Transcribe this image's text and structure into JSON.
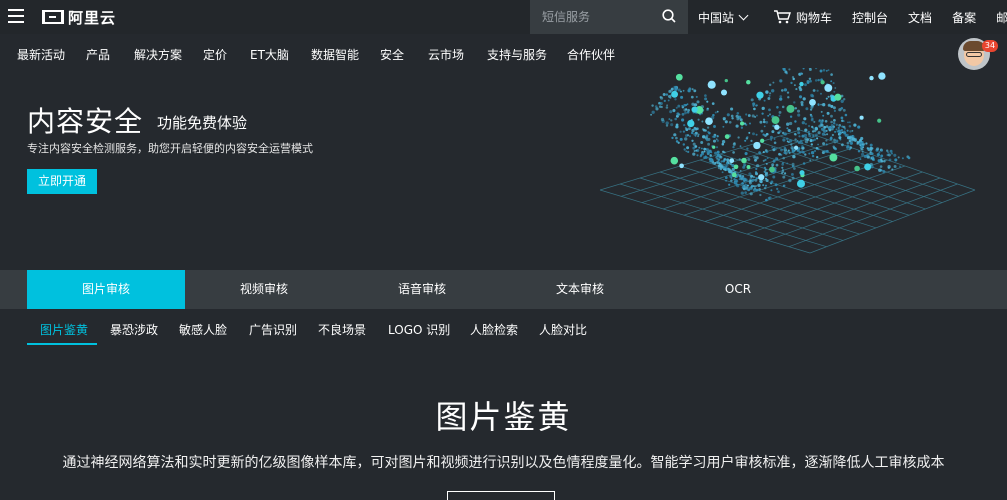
{
  "topbar": {
    "logo_text": "阿里云",
    "search_placeholder": "短信服务",
    "region": "中国站",
    "cart": "购物车",
    "links": [
      "控制台",
      "文档",
      "备案",
      "邮箱"
    ]
  },
  "mainnav": {
    "items": [
      "最新活动",
      "产品",
      "解决方案",
      "定价",
      "ET大脑",
      "数据智能",
      "安全",
      "云市场",
      "支持与服务",
      "合作伙伴"
    ]
  },
  "user": {
    "badge_count": "34"
  },
  "hero": {
    "title": "内容安全",
    "subtitle": "功能免费体验",
    "description": "专注内容安全检测服务，助您开启轻便的内容安全运营模式",
    "button": "立即开通"
  },
  "tabs": [
    {
      "label": "图片审核",
      "active": true
    },
    {
      "label": "视频审核",
      "active": false
    },
    {
      "label": "语音审核",
      "active": false
    },
    {
      "label": "文本审核",
      "active": false
    },
    {
      "label": "OCR",
      "active": false
    }
  ],
  "subtabs": [
    {
      "label": "图片鉴黄",
      "active": true
    },
    {
      "label": "暴恐涉政",
      "active": false
    },
    {
      "label": "敏感人脸",
      "active": false
    },
    {
      "label": "广告识别",
      "active": false
    },
    {
      "label": "不良场景",
      "active": false
    },
    {
      "label": "LOGO 识别",
      "active": false
    },
    {
      "label": "人脸检索",
      "active": false
    },
    {
      "label": "人脸对比",
      "active": false
    }
  ],
  "section": {
    "title": "图片鉴黄",
    "description": "通过神经网络算法和实时更新的亿级图像样本库，可对图片和视频进行识别以及色情程度量化。智能学习用户审核标准，逐渐降低人工审核成本"
  },
  "colors": {
    "accent": "#00c1de",
    "background": "#25292e",
    "tabbar": "#373d41",
    "badge": "#e8452f"
  },
  "icons": {
    "menu": "hamburger-menu-icon",
    "search": "search-icon",
    "cart": "shopping-cart-icon",
    "region_dropdown": "chevron-down-icon"
  }
}
